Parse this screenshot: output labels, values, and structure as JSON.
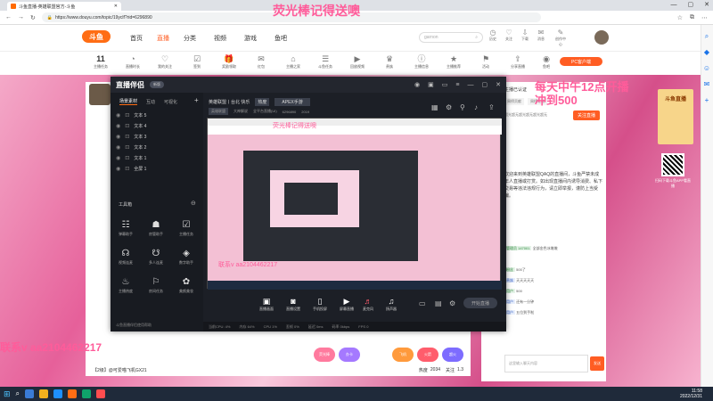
{
  "browser": {
    "tab_title": "斗鱼直播-英雄联盟官方-斗鱼",
    "url": "https://www.douyu.com/topic/19yclf?rid=6296890",
    "window_controls": [
      "—",
      "▢",
      "✕"
    ]
  },
  "nav": {
    "logo": "斗鱼",
    "items": [
      "首页",
      "直播",
      "分类",
      "视频",
      "游戏",
      "鱼吧"
    ],
    "search_placeholder": "garnon",
    "top_icons": [
      "历史",
      "关注",
      "下载",
      "消息",
      "创作中心"
    ]
  },
  "room_toolbar": {
    "items": [
      "11",
      "直播时长",
      "我的关注",
      "签到",
      "奖励领取",
      "红包",
      "主播之家",
      "斗鱼任务",
      "回放视频",
      "贵族",
      "主播信息",
      "主播推荐",
      "活动",
      "分享直播",
      "鱼吧"
    ],
    "first_label": "主播任务",
    "pc_button": "PC客户端"
  },
  "obs": {
    "logo": "直播伴侣",
    "badge": "新版",
    "side_tabs": [
      "场景素材",
      "互动",
      "可视化"
    ],
    "layers": [
      "文本 5",
      "文本 4",
      "文本 3",
      "文本 2",
      "文本 1",
      "全屏 1"
    ],
    "tools_title": "工具箱",
    "tools": [
      "弹幕助手",
      "房管助手",
      "主播任务",
      "视频连麦",
      "多人连麦",
      "数字助手",
      "主播热度",
      "房间任务",
      "美颜美妆"
    ],
    "footer": "斗鱼直播伴侣使用帮助",
    "stream_info": [
      "英雄联盟丨台北 快乐",
      "热度",
      "APEX手游"
    ],
    "stream_info2": [
      "英雄联盟",
      "大神解说",
      "全平台直播(UI)",
      "6296890",
      "2019"
    ],
    "controls": [
      "直播画面",
      "直播设置",
      "手机投屏",
      "屏幕直播",
      "麦克风",
      "扬声器"
    ],
    "start_button": "开始直播",
    "status": [
      "当前CPU: 4%",
      "内存 64%",
      "CPU 1%",
      "丢帧 0%",
      "延迟 0ms",
      "码率 0kbps",
      "FPS 0"
    ]
  },
  "right_panel": {
    "header": "主播已认证",
    "tabs": [
      "周榜贡献",
      "周榜礼物",
      "粉丝团",
      "直播间"
    ],
    "rank_text": "超光超无超光超无超光超无",
    "follow": "关注直播",
    "chat": "欢迎来到英雄联盟QAQ的直播间，斗鱼严禁未成年人直播或打赏。如出现直播间内诱导消费、私下交易等违法违规行为，请立即举报，谨防上当受骗。",
    "chat_lines": [
      {
        "tag": "管理员 147001",
        "text": "全部金色冰墩墩"
      },
      {
        "tag": "粉丝",
        "text": "500了"
      },
      {
        "tag": "贵族",
        "text": "天天天天天"
      },
      {
        "tag": "用户",
        "text": "500"
      },
      {
        "tag": "用户",
        "text": "还有一分钟"
      },
      {
        "tag": "用户",
        "text": "五位到手啦"
      }
    ],
    "chat_placeholder": "这里输入聊天内容",
    "send": "发送"
  },
  "promo": {
    "title": "斗鱼直播",
    "qr_text": "扫码下载斗鱼APP看直播"
  },
  "bottom": {
    "text": "【2级】@可爱喵飞机GX21",
    "gift_labels": [
      "荧光棒",
      "办卡",
      "飞机",
      "火箭",
      "超火"
    ],
    "stats": [
      "热度",
      "2034",
      "关注",
      "1.3"
    ]
  },
  "overlays": {
    "top": "荧光棒记得送噢",
    "right": "每天中午12点开播\n冲到500",
    "left": "联系v  aa2104462217",
    "small1": "联系v aa2104462217",
    "small2": "荧光棒记得送噢"
  },
  "taskbar": {
    "time": "11:58",
    "date": "2022/12/31"
  }
}
